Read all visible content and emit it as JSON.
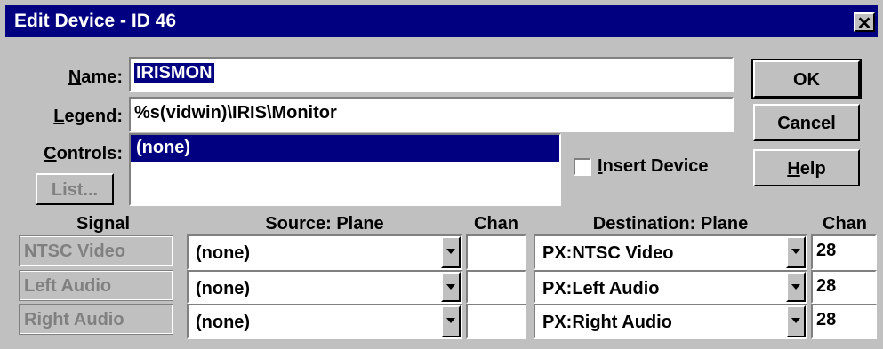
{
  "window": {
    "title": "Edit Device - ID 46",
    "close_glyph": "✕"
  },
  "labels": {
    "name": "Name:",
    "name_key": "N",
    "legend": "Legend:",
    "legend_key": "L",
    "controls": "Controls:",
    "controls_key": "C"
  },
  "fields": {
    "name_value": "IRISMON",
    "legend_value": "%s(vidwin)\\IRIS\\Monitor"
  },
  "controls_list": {
    "items": [
      "(none)"
    ]
  },
  "buttons": {
    "ok": "OK",
    "cancel": "Cancel",
    "help": "Help",
    "help_key": "H",
    "list": "List..."
  },
  "insert_device": {
    "label": "Insert Device",
    "key": "I",
    "checked": false
  },
  "table": {
    "headers": {
      "signal": "Signal",
      "source_plane": "Source: Plane",
      "source_chan": "Chan",
      "dest_plane": "Destination: Plane",
      "dest_chan": "Chan"
    },
    "rows": [
      {
        "signal": "NTSC Video",
        "source": "(none)",
        "source_chan": "",
        "destination": "PX:NTSC Video",
        "dest_chan": "28"
      },
      {
        "signal": "Left Audio",
        "source": "(none)",
        "source_chan": "",
        "destination": "PX:Left Audio",
        "dest_chan": "28"
      },
      {
        "signal": "Right Audio",
        "source": "(none)",
        "source_chan": "",
        "destination": "PX:Right Audio",
        "dest_chan": "28"
      }
    ]
  },
  "colors": {
    "titlebar": "#000080",
    "face": "#c0c0c0",
    "highlight": "#000080"
  }
}
